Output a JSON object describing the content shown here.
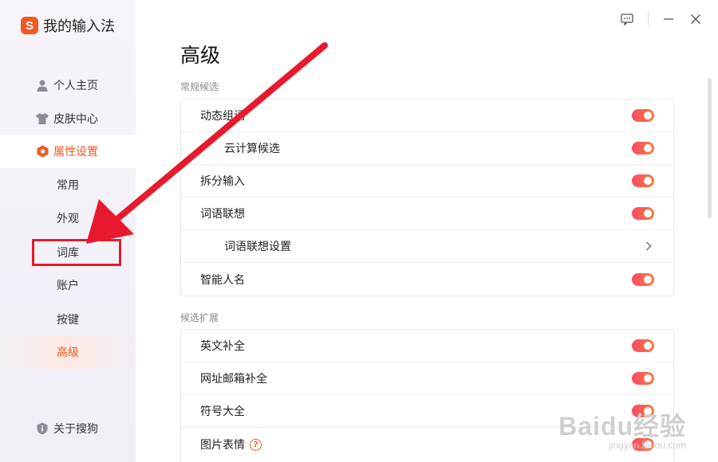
{
  "app": {
    "logo_letter": "S",
    "title": "我的输入法"
  },
  "sidebar": {
    "items": [
      {
        "label": "个人主页",
        "icon": "user-icon"
      },
      {
        "label": "皮肤中心",
        "icon": "shirt-icon"
      },
      {
        "label": "属性设置",
        "icon": "hexagon-settings-icon",
        "active": true
      }
    ],
    "sub_items": [
      {
        "label": "常用"
      },
      {
        "label": "外观"
      },
      {
        "label": "词库"
      },
      {
        "label": "账户"
      },
      {
        "label": "按键"
      },
      {
        "label": "高级",
        "selected": true
      }
    ],
    "about": {
      "label": "关于搜狗",
      "icon": "info-shield-icon"
    }
  },
  "main": {
    "title": "高级",
    "sections": [
      {
        "title": "常规候选",
        "rows": [
          {
            "label": "动态组词",
            "control": "toggle",
            "on": true
          },
          {
            "label": "云计算候选",
            "control": "toggle",
            "on": true,
            "indent": true
          },
          {
            "label": "拆分输入",
            "control": "toggle",
            "on": true
          },
          {
            "label": "词语联想",
            "control": "toggle",
            "on": true
          },
          {
            "label": "词语联想设置",
            "control": "chevron",
            "indent": true
          },
          {
            "label": "智能人名",
            "control": "toggle",
            "on": true
          }
        ]
      },
      {
        "title": "候选扩展",
        "rows": [
          {
            "label": "英文补全",
            "control": "toggle",
            "on": true
          },
          {
            "label": "网址邮箱补全",
            "control": "toggle",
            "on": true
          },
          {
            "label": "符号大全",
            "control": "toggle",
            "on": true
          },
          {
            "label": "图片表情",
            "control": "toggle",
            "on": true,
            "help": "?"
          }
        ]
      }
    ]
  },
  "watermark": {
    "main": "Baidu经验",
    "sub": "jingyan.baidu.com"
  },
  "colors": {
    "accent": "#f05a22",
    "toggle_start": "#fa4b63",
    "toggle_end": "#fb7b3d",
    "annotation_red": "#e8192c"
  }
}
